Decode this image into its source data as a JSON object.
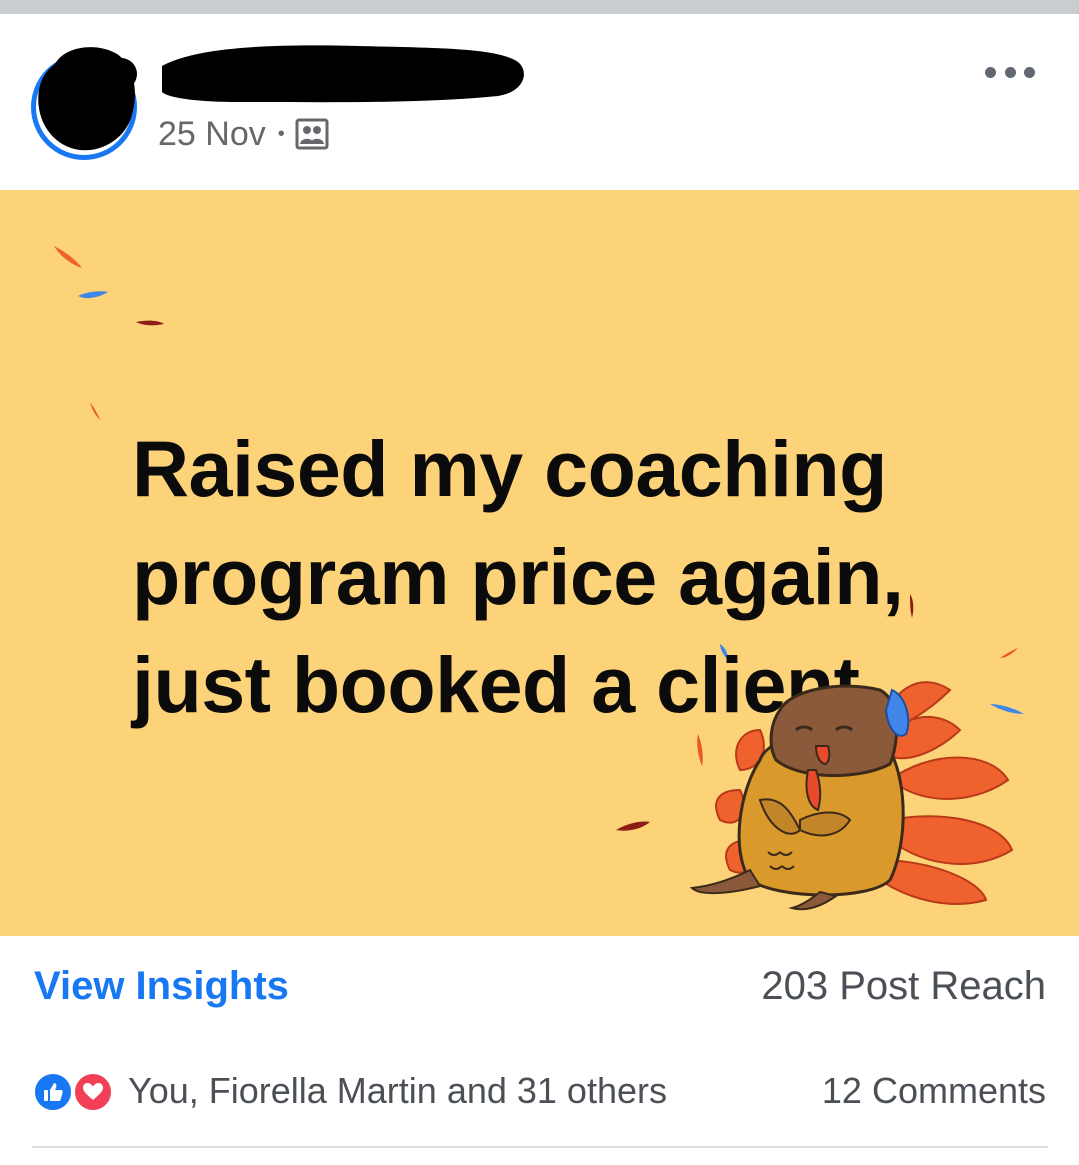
{
  "post": {
    "author_name": "",
    "date": "25 Nov",
    "separator": "•",
    "audience_icon": "friends-audience-icon",
    "more_icon": "more-options-icon",
    "text": "Raised my coaching program price again, just booked a client.",
    "background_color": "#fdd379",
    "sticker": "thanksgiving-dog-turkey-sticker"
  },
  "insights": {
    "view_label": "View Insights",
    "reach_label": "203 Post Reach"
  },
  "reactions": {
    "icons": [
      "like-icon",
      "love-icon"
    ],
    "summary": "You, Fiorella Martin and 31 others",
    "comments": "12 Comments"
  },
  "colors": {
    "link_blue": "#1877f2",
    "love_red": "#f33e58",
    "meta_gray": "#65676b"
  }
}
